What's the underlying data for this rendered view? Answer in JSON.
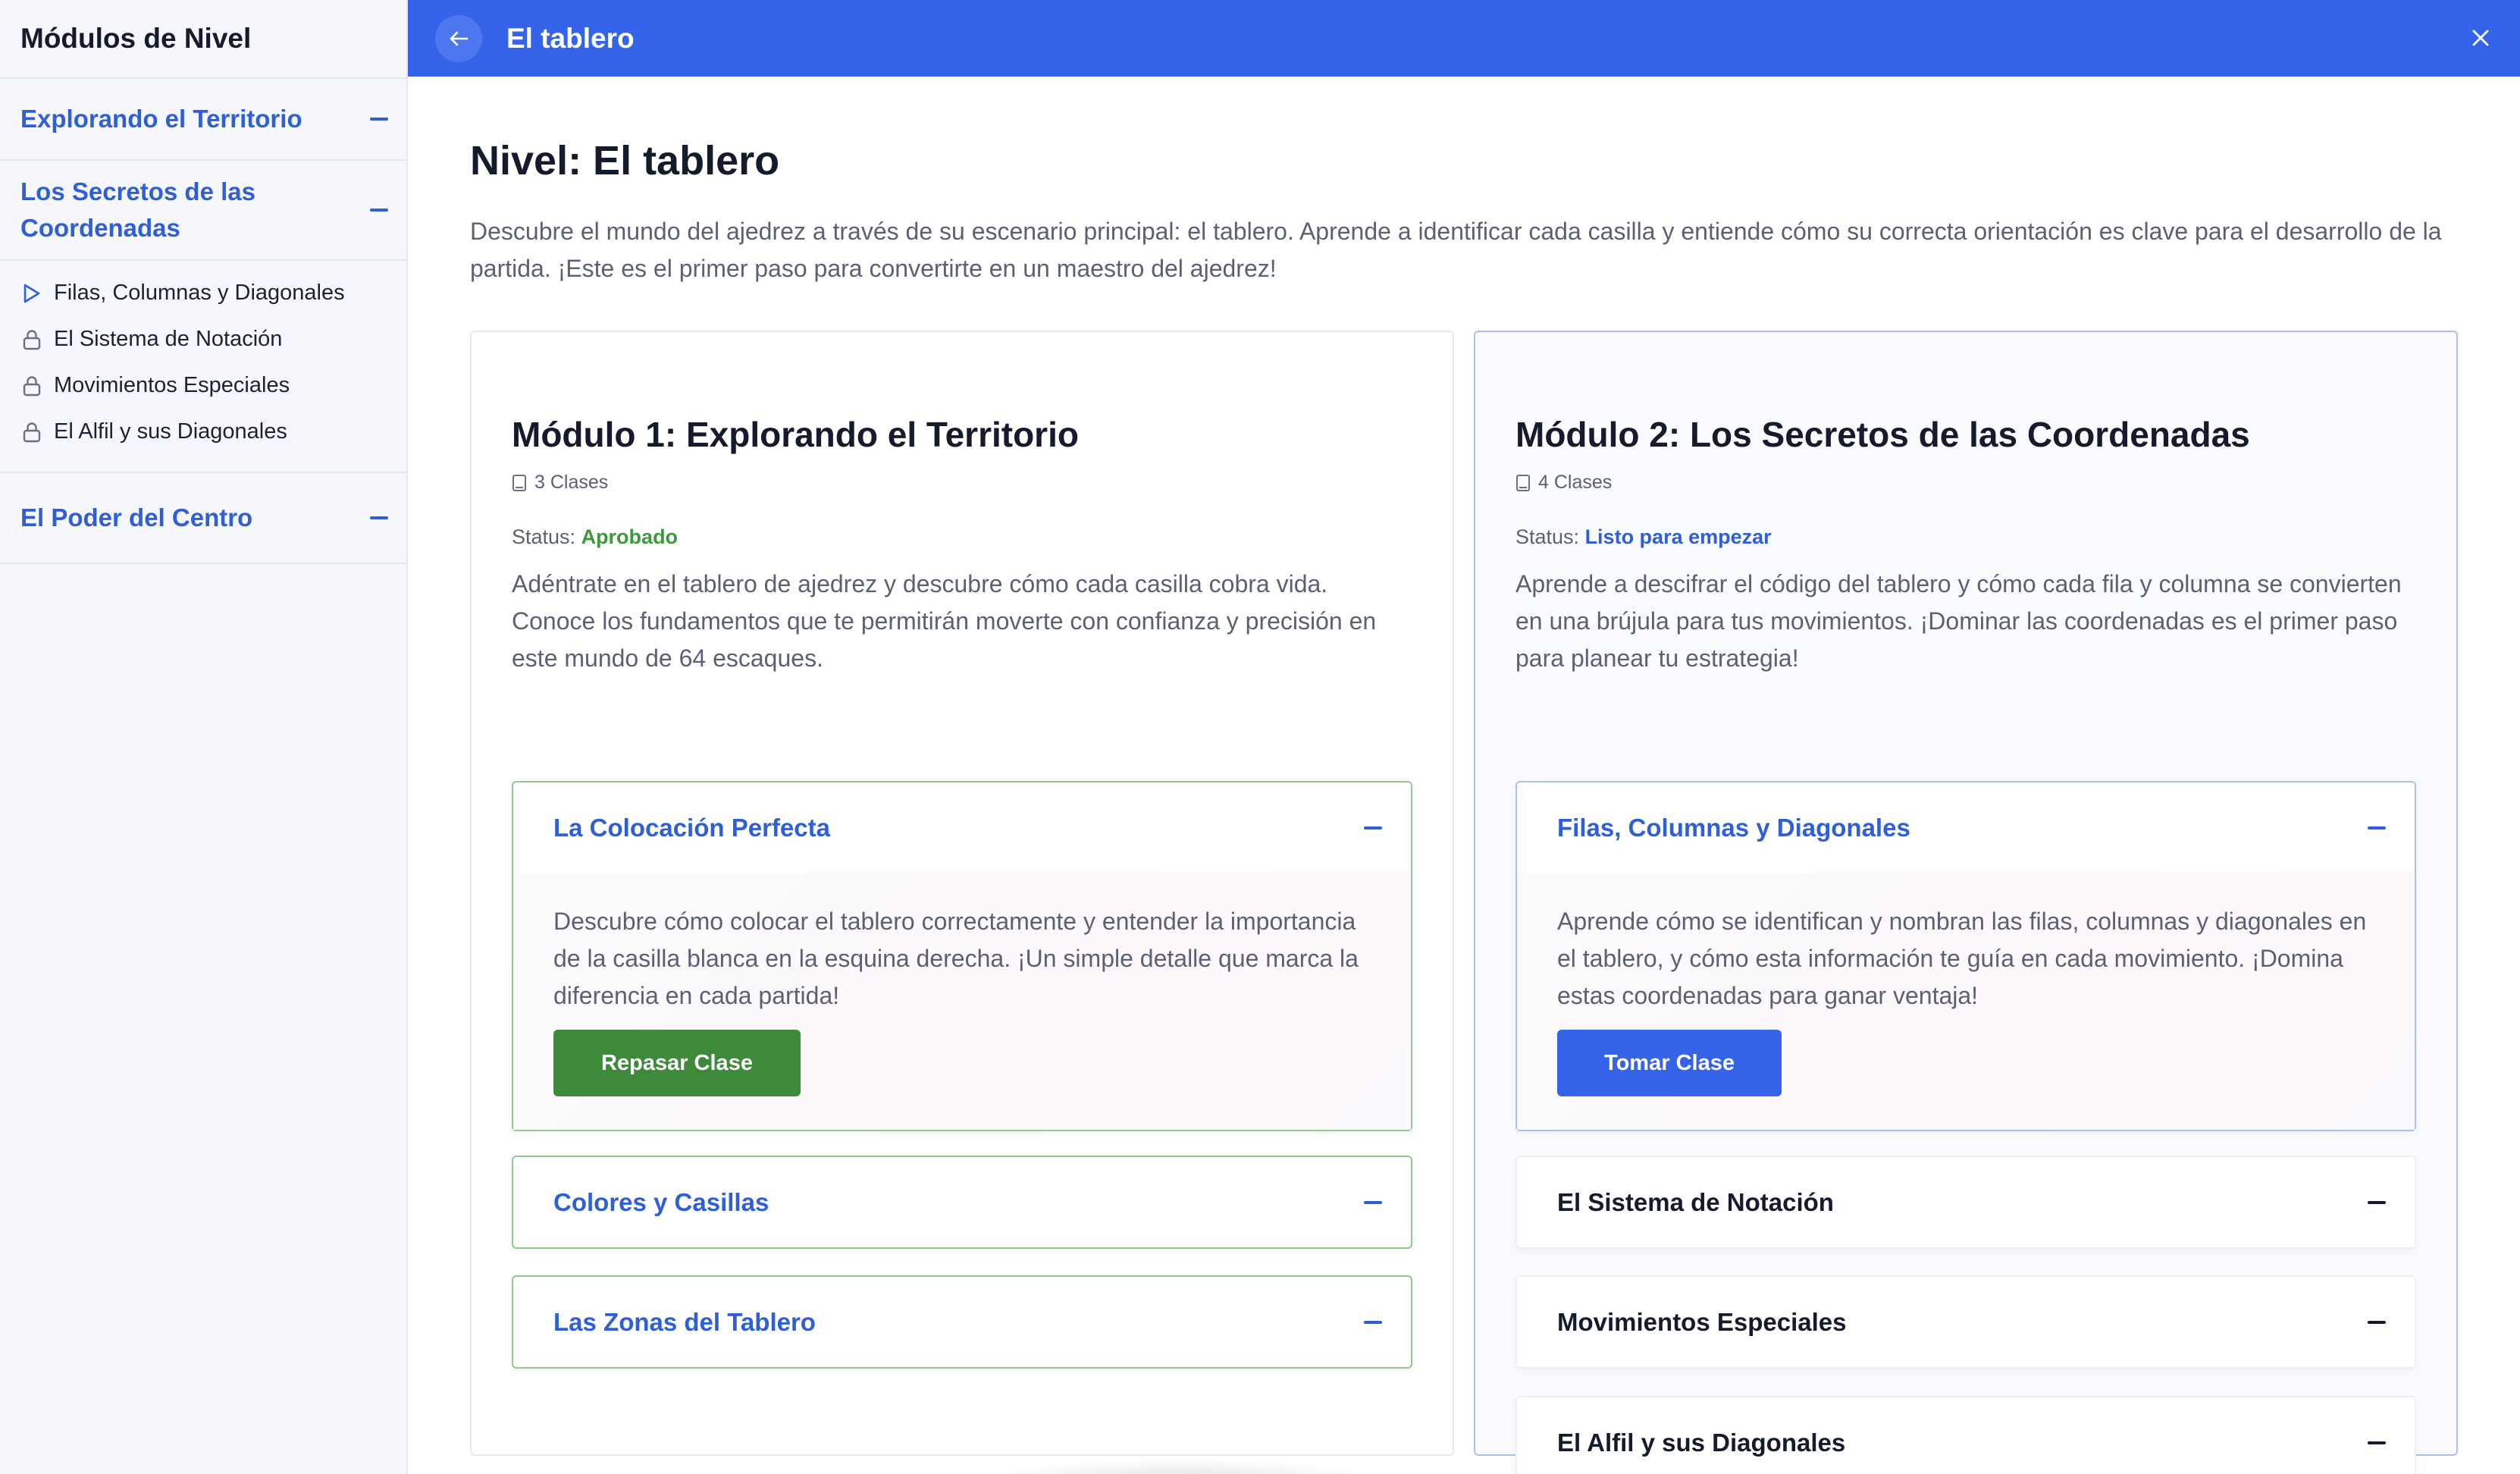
{
  "sidebar": {
    "title": "Módulos de Nivel",
    "sections": [
      {
        "label": "Explorando el Territorio"
      },
      {
        "label": "Los Secretos de las Coordenadas"
      },
      {
        "label": "El Poder del Centro"
      }
    ],
    "items": [
      {
        "label": "Filas, Columnas y Diagonales",
        "icon": "play-icon"
      },
      {
        "label": "El Sistema de Notación",
        "icon": "lock-icon"
      },
      {
        "label": "Movimientos Especiales",
        "icon": "lock-icon"
      },
      {
        "label": "El Alfil y sus Diagonales",
        "icon": "lock-icon"
      }
    ]
  },
  "header": {
    "title": "El tablero"
  },
  "main": {
    "title": "Nivel: El tablero",
    "description": "Descubre el mundo del ajedrez a través de su escenario principal: el tablero. Aprende a identificar cada casilla y entiende cómo su correcta orientación es clave para el desarrollo de la partida. ¡Este es el primer paso para convertirte en un maestro del ajedrez!"
  },
  "modules": [
    {
      "title": "Módulo 1: Explorando el Territorio",
      "count": "3 Clases",
      "status_label": "Status:",
      "status_value": "Aprobado",
      "status_color": "#3d9a3a",
      "description": "Adéntrate en el tablero de ajedrez y descubre cómo cada casilla cobra vida. Conoce los fundamentos que te permitirán moverte con confianza y precisión en este mundo de 64 escaques.",
      "lessons": [
        {
          "title": "La Colocación Perfecta",
          "body": "Descubre cómo colocar el tablero correctamente y entender la importancia de la casilla blanca en la esquina derecha. ¡Un simple detalle que marca la diferencia en cada partida!",
          "button": "Repasar Clase"
        },
        {
          "title": "Colores y Casillas"
        },
        {
          "title": "Las Zonas del Tablero"
        }
      ]
    },
    {
      "title": "Módulo 2: Los Secretos de las Coordenadas",
      "count": "4 Clases",
      "status_label": "Status:",
      "status_value": "Listo para empezar",
      "status_color": "#2f5fd8",
      "description": "Aprende a descifrar el código del tablero y cómo cada fila y columna se convierten en una brújula para tus movimientos. ¡Dominar las coordenadas es el primer paso para planear tu estrategia!",
      "lessons": [
        {
          "title": "Filas, Columnas y Diagonales",
          "body": "Aprende cómo se identifican y nombran las filas, columnas y diagonales en el tablero, y cómo esta información te guía en cada movimiento. ¡Domina estas coordenadas para ganar ventaja!",
          "button": "Tomar Clase"
        },
        {
          "title": "El Sistema de Notación"
        },
        {
          "title": "Movimientos Especiales"
        },
        {
          "title": "El Alfil y sus Diagonales"
        }
      ]
    }
  ],
  "colors": {
    "accent": "#3563e9",
    "approved": "#3d8b3a"
  }
}
